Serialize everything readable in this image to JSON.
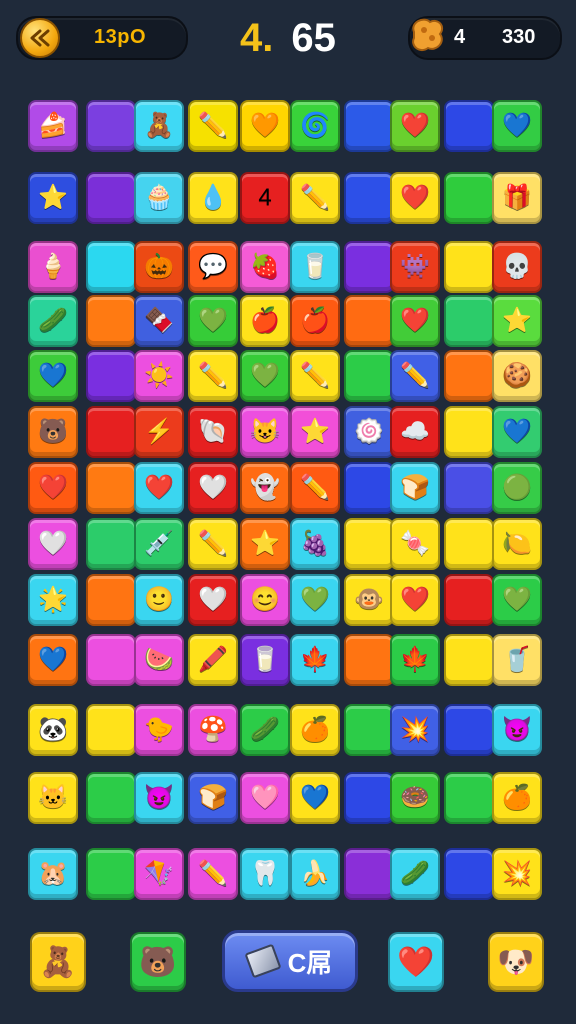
{
  "header": {
    "coins": "13pO",
    "level_prefix": "4.",
    "level_value": "65",
    "stars_count": "4",
    "stars_total": "330"
  },
  "board": {
    "rows": [
      [
        [
          "#b14be8",
          "🍰"
        ],
        [
          "#7b3fe0",
          ""
        ],
        [
          "#3fd9f5",
          "🧸"
        ],
        [
          "#f6e100",
          "✏️"
        ],
        [
          "#ffd600",
          "🧡"
        ],
        [
          "#39d33a",
          "🌀"
        ],
        [
          "#2c5ae8",
          ""
        ],
        [
          "#6ad02e",
          "❤️"
        ],
        [
          "#2d48e6",
          ""
        ],
        [
          "#33cc44",
          "💙"
        ]
      ],
      [
        [
          "#2e4ee0",
          "⭐"
        ],
        [
          "#7b2fd8",
          ""
        ],
        [
          "#45d3ef",
          "🧁"
        ],
        [
          "#ffe21a",
          "💧"
        ],
        [
          "#e62020",
          "4"
        ],
        [
          "#ffe21a",
          "✏️"
        ],
        [
          "#2d50e8",
          ""
        ],
        [
          "#ffe21a",
          "❤️"
        ],
        [
          "#2fcc3d",
          ""
        ],
        [
          "#ffe066",
          "🎁"
        ]
      ],
      [
        [
          "#ea4fd0",
          "🍦"
        ],
        [
          "#2bd8f0",
          ""
        ],
        [
          "#ec4a14",
          "🎃"
        ],
        [
          "#ff5a1a",
          "💬"
        ],
        [
          "#f55bd6",
          "🍓"
        ],
        [
          "#3ad6f0",
          "🥛"
        ],
        [
          "#7a2fe0",
          ""
        ],
        [
          "#ec3b1c",
          "👾"
        ],
        [
          "#ffe21a",
          ""
        ],
        [
          "#ec3b1c",
          "💀"
        ]
      ],
      [
        [
          "#2ad39a",
          "🥒"
        ],
        [
          "#ff7a12",
          ""
        ],
        [
          "#4060e0",
          "🍫"
        ],
        [
          "#36cc38",
          "💚"
        ],
        [
          "#ffe21a",
          "🍎"
        ],
        [
          "#ff5a12",
          "🍎"
        ],
        [
          "#ff6b12",
          ""
        ],
        [
          "#42cc38",
          "❤️"
        ],
        [
          "#2ccc6a",
          ""
        ],
        [
          "#5adc3e",
          "⭐"
        ]
      ],
      [
        [
          "#3dcc3a",
          "💙"
        ],
        [
          "#7a2fe0",
          ""
        ],
        [
          "#ec4fe0",
          "☀️"
        ],
        [
          "#ffe21a",
          "✏️"
        ],
        [
          "#36cc38",
          "💚"
        ],
        [
          "#ffe21a",
          "✏️"
        ],
        [
          "#2ccc48",
          ""
        ],
        [
          "#4060e6",
          "✏️"
        ],
        [
          "#ff7412",
          ""
        ],
        [
          "#ffe066",
          "🍪"
        ]
      ],
      [
        [
          "#ff7a12",
          "🐻"
        ],
        [
          "#e62020",
          ""
        ],
        [
          "#ec3b1c",
          "⚡"
        ],
        [
          "#e62020",
          "🐚"
        ],
        [
          "#ec4fe0",
          "😺"
        ],
        [
          "#f24fd8",
          "⭐"
        ],
        [
          "#4060e0",
          "🍥"
        ],
        [
          "#e62020",
          "☁️"
        ],
        [
          "#ffe21a",
          ""
        ],
        [
          "#33cc70",
          "💙"
        ]
      ],
      [
        [
          "#ff5a12",
          "❤️"
        ],
        [
          "#ff7a12",
          ""
        ],
        [
          "#3ad6f0",
          "❤️"
        ],
        [
          "#e62020",
          "🤍"
        ],
        [
          "#ff6b12",
          "👻"
        ],
        [
          "#ff5a12",
          "✏️"
        ],
        [
          "#2d48e6",
          ""
        ],
        [
          "#3ad6f0",
          "🍞"
        ],
        [
          "#4a4fe6",
          ""
        ],
        [
          "#36cc48",
          "🟢"
        ]
      ],
      [
        [
          "#ec4fe0",
          "🤍"
        ],
        [
          "#2ccc6a",
          ""
        ],
        [
          "#2ccc6a",
          "💉"
        ],
        [
          "#ffe21a",
          "✏️"
        ],
        [
          "#ff7412",
          "⭐"
        ],
        [
          "#3ad6f0",
          "🍇"
        ],
        [
          "#ffe21a",
          ""
        ],
        [
          "#ffe21a",
          "🍬"
        ],
        [
          "#ffe21a",
          ""
        ],
        [
          "#ffe21a",
          "🍋"
        ]
      ],
      [
        [
          "#3ad6f0",
          "🌟"
        ],
        [
          "#ff7412",
          ""
        ],
        [
          "#3ad6f0",
          "🙂"
        ],
        [
          "#e62020",
          "🤍"
        ],
        [
          "#ec4fe0",
          "😊"
        ],
        [
          "#3ad6f0",
          "💚"
        ],
        [
          "#ffe21a",
          "🐵"
        ],
        [
          "#ffe21a",
          "❤️"
        ],
        [
          "#e62020",
          ""
        ],
        [
          "#2ccc48",
          "💚"
        ]
      ],
      [
        [
          "#ff7412",
          "💙"
        ],
        [
          "#ec4fe0",
          ""
        ],
        [
          "#ec4fe0",
          "🍉"
        ],
        [
          "#ffe21a",
          "🖍️"
        ],
        [
          "#7a2fe0",
          "🥛"
        ],
        [
          "#3ad6f0",
          "🍁"
        ],
        [
          "#ff7412",
          ""
        ],
        [
          "#2ccc48",
          "🍁"
        ],
        [
          "#ffe21a",
          ""
        ],
        [
          "#ffe066",
          "🥤"
        ]
      ],
      [
        [
          "#ffe21a",
          "🐼"
        ],
        [
          "#ffe21a",
          ""
        ],
        [
          "#ec4fe0",
          "🐤"
        ],
        [
          "#ec4fe0",
          "🍄"
        ],
        [
          "#2ccc48",
          "🥒"
        ],
        [
          "#ffe21a",
          "🍊"
        ],
        [
          "#2ccc48",
          ""
        ],
        [
          "#4060e6",
          "💥"
        ],
        [
          "#2d48e6",
          ""
        ],
        [
          "#3ad6f0",
          "😈"
        ]
      ],
      [
        [
          "#ffe21a",
          "🐱"
        ],
        [
          "#2ccc48",
          ""
        ],
        [
          "#3ad6f0",
          "😈"
        ],
        [
          "#4060e6",
          "🍞"
        ],
        [
          "#ec4fe0",
          "🩷"
        ],
        [
          "#ffe21a",
          "💙"
        ],
        [
          "#2d48e6",
          ""
        ],
        [
          "#36cc38",
          "🍩"
        ],
        [
          "#2ccc48",
          ""
        ],
        [
          "#ffe21a",
          "🍊"
        ]
      ],
      [
        [
          "#3ad6f0",
          "🐹"
        ],
        [
          "#2ccc48",
          ""
        ],
        [
          "#ec4fe0",
          "🪁"
        ],
        [
          "#ec4fe0",
          "✏️"
        ],
        [
          "#3ad6f0",
          "🦷"
        ],
        [
          "#3ad6f0",
          "🍌"
        ],
        [
          "#8a2fd8",
          ""
        ],
        [
          "#3ad6f0",
          "🥒"
        ],
        [
          "#2d48e6",
          ""
        ],
        [
          "#ffe21a",
          "💥"
        ]
      ]
    ]
  },
  "bottom": {
    "left_icon": "🧸",
    "bear_icon": "🐻",
    "center_label": "C屌",
    "heart_icon": "❤️",
    "right_icon": "🐶"
  }
}
